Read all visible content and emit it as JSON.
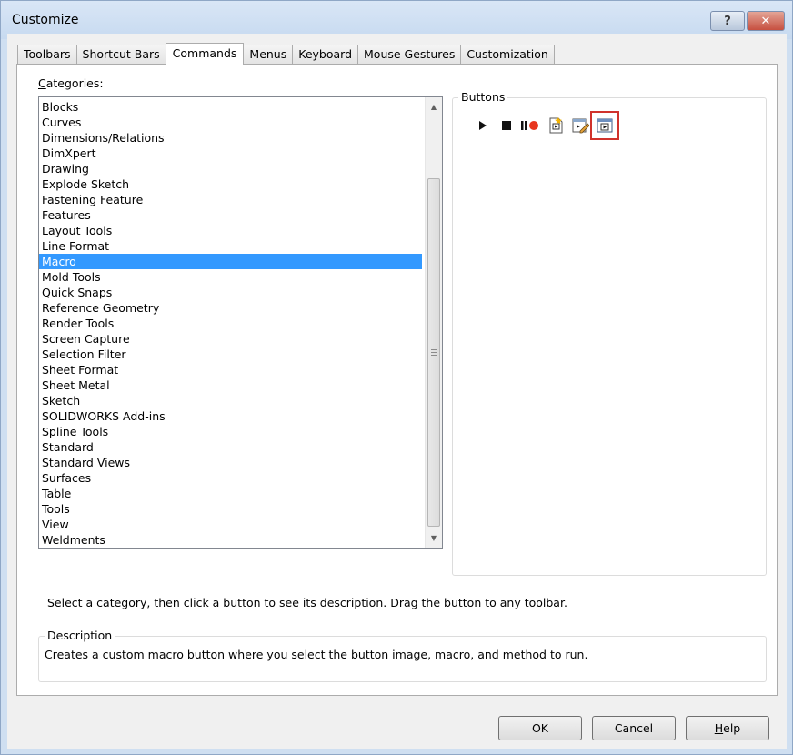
{
  "window": {
    "title": "Customize",
    "help_glyph": "?",
    "close_glyph": "✕"
  },
  "tabs": [
    {
      "label": "Toolbars",
      "active": false
    },
    {
      "label": "Shortcut Bars",
      "active": false
    },
    {
      "label": "Commands",
      "active": true
    },
    {
      "label": "Menus",
      "active": false
    },
    {
      "label": "Keyboard",
      "active": false
    },
    {
      "label": "Mouse Gestures",
      "active": false
    },
    {
      "label": "Customization",
      "active": false
    }
  ],
  "categories": {
    "label_accel": "C",
    "label_rest": "ategories:",
    "selected": "Macro",
    "items": [
      "Blocks",
      "Curves",
      "Dimensions/Relations",
      "DimXpert",
      "Drawing",
      "Explode Sketch",
      "Fastening Feature",
      "Features",
      "Layout Tools",
      "Line Format",
      "Macro",
      "Mold Tools",
      "Quick Snaps",
      "Reference Geometry",
      "Render Tools",
      "Screen Capture",
      "Selection Filter",
      "Sheet Format",
      "Sheet Metal",
      "Sketch",
      "SOLIDWORKS Add-ins",
      "Spline Tools",
      "Standard",
      "Standard Views",
      "Surfaces",
      "Table",
      "Tools",
      "View",
      "Weldments"
    ]
  },
  "buttons_group": {
    "label": "Buttons",
    "icons": [
      "play-macro-icon",
      "stop-macro-icon",
      "pause-record-macro-icon",
      "new-macro-icon",
      "edit-macro-icon",
      "custom-macro-button-icon"
    ],
    "highlighted": "custom-macro-button-icon",
    "highlight_color": "#d0322c"
  },
  "hint": "Select a category, then click a button to see its description. Drag the button to any toolbar.",
  "description": {
    "label": "Description",
    "text": "Creates a custom macro button where you select the button image, macro, and method to run."
  },
  "dialog_buttons": {
    "ok": "OK",
    "cancel": "Cancel",
    "help_accel": "H",
    "help_rest": "elp"
  },
  "colors": {
    "selection": "#3399ff",
    "record_dot": "#e8361e"
  }
}
